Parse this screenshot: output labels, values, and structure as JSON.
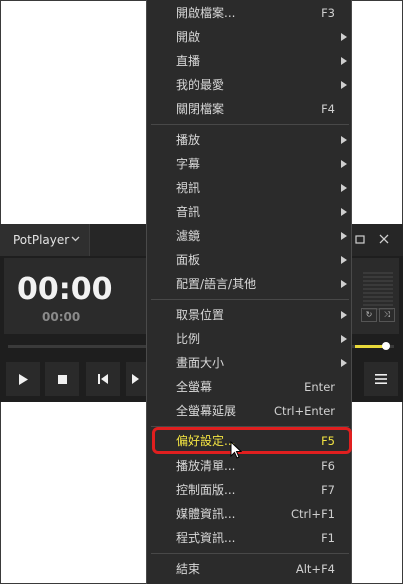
{
  "player": {
    "app_title": "PotPlayer",
    "time_main": "00:00",
    "time_sub": "00:00"
  },
  "menu": {
    "groups": [
      [
        {
          "label": "開啟檔案...",
          "shortcut": "F3",
          "submenu": false
        },
        {
          "label": "開啟",
          "shortcut": "",
          "submenu": true
        },
        {
          "label": "直播",
          "shortcut": "",
          "submenu": true
        },
        {
          "label": "我的最愛",
          "shortcut": "",
          "submenu": true
        },
        {
          "label": "關閉檔案",
          "shortcut": "F4",
          "submenu": false
        }
      ],
      [
        {
          "label": "播放",
          "shortcut": "",
          "submenu": true
        },
        {
          "label": "字幕",
          "shortcut": "",
          "submenu": true
        },
        {
          "label": "視訊",
          "shortcut": "",
          "submenu": true
        },
        {
          "label": "音訊",
          "shortcut": "",
          "submenu": true
        },
        {
          "label": "濾鏡",
          "shortcut": "",
          "submenu": true
        },
        {
          "label": "面板",
          "shortcut": "",
          "submenu": true
        },
        {
          "label": "配置/語言/其他",
          "shortcut": "",
          "submenu": true
        }
      ],
      [
        {
          "label": "取景位置",
          "shortcut": "",
          "submenu": true
        },
        {
          "label": "比例",
          "shortcut": "",
          "submenu": true
        },
        {
          "label": "畫面大小",
          "shortcut": "",
          "submenu": true
        },
        {
          "label": "全螢幕",
          "shortcut": "Enter",
          "submenu": false
        },
        {
          "label": "全螢幕延展",
          "shortcut": "Ctrl+Enter",
          "submenu": false
        }
      ],
      [
        {
          "label": "偏好設定...",
          "shortcut": "F5",
          "submenu": false,
          "highlighted": true
        },
        {
          "label": "播放清單...",
          "shortcut": "F6",
          "submenu": false
        },
        {
          "label": "控制面版...",
          "shortcut": "F7",
          "submenu": false
        },
        {
          "label": "媒體資訊...",
          "shortcut": "Ctrl+F1",
          "submenu": false
        },
        {
          "label": "程式資訊...",
          "shortcut": "F1",
          "submenu": false
        }
      ],
      [
        {
          "label": "結束",
          "shortcut": "Alt+F4",
          "submenu": false
        }
      ]
    ]
  },
  "colors": {
    "menu_bg": "#2b2b2b",
    "highlight_text": "#f4e542",
    "highlight_border": "#e01f1f",
    "volume_accent": "#e8d93a"
  }
}
